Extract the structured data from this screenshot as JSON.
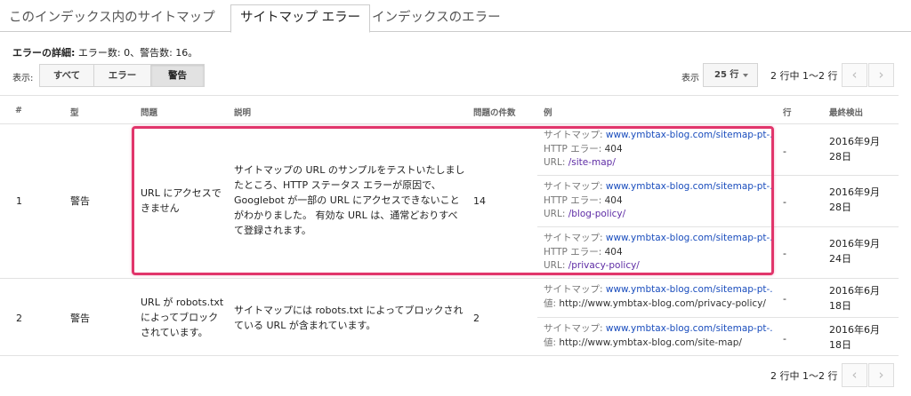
{
  "tabs": [
    {
      "label": "このインデックス内のサイトマップ"
    },
    {
      "label": "サイトマップ エラー"
    },
    {
      "label": "インデックスのエラー"
    }
  ],
  "details": {
    "title": "エラーの詳細:",
    "summary": " エラー数: 0、警告数: 16。"
  },
  "filter": {
    "label": "表示:",
    "options": [
      "すべて",
      "エラー",
      "警告"
    ],
    "selected": "警告"
  },
  "rows_per_page": {
    "label": "表示",
    "value": "25 行"
  },
  "pagination": {
    "text": "2 行中 1〜2 行",
    "prev": "‹",
    "next": "›"
  },
  "table": {
    "headers": {
      "num": "#",
      "type": "型",
      "issue": "問題",
      "description": "説明",
      "count": "問題の件数",
      "example": "例",
      "line": "行",
      "last_detected": "最終検出"
    },
    "rows": [
      {
        "num": "1",
        "type": "警告",
        "issue": "URL にアクセスできません",
        "description": "サイトマップの URL のサンプルをテストいたしましたところ、HTTP ステータス エラーが原因で、Googlebot が一部の URL にアクセスできないことがわかりました。 有効な URL は、通常どおりすべて登録されます。",
        "count": "14",
        "examples": [
          {
            "sitemap_label": "サイトマップ: ",
            "sitemap_url": "www.ymbtax-blog.com/sitemap-pt-...",
            "http_label": "HTTP エラー: ",
            "http_value": "404",
            "url_label": "URL: ",
            "url_value": "/site-map/",
            "line": "-",
            "date": "2016年9月28日"
          },
          {
            "sitemap_label": "サイトマップ: ",
            "sitemap_url": "www.ymbtax-blog.com/sitemap-pt-...",
            "http_label": "HTTP エラー: ",
            "http_value": "404",
            "url_label": "URL: ",
            "url_value": "/blog-policy/",
            "line": "-",
            "date": "2016年9月28日"
          },
          {
            "sitemap_label": "サイトマップ: ",
            "sitemap_url": "www.ymbtax-blog.com/sitemap-pt-...",
            "http_label": "HTTP エラー: ",
            "http_value": "404",
            "url_label": "URL: ",
            "url_value": "/privacy-policy/",
            "line": "-",
            "date": "2016年9月24日"
          }
        ]
      },
      {
        "num": "2",
        "type": "警告",
        "issue": "URL が robots.txt によってブロックされています。",
        "description": "サイトマップには robots.txt によってブロックされている URL が含まれています。",
        "count": "2",
        "examples": [
          {
            "sitemap_label": "サイトマップ: ",
            "sitemap_url": "www.ymbtax-blog.com/sitemap-pt-...",
            "value_label": "値: ",
            "value": "http://www.ymbtax-blog.com/privacy-policy/",
            "line": "-",
            "date": "2016年6月18日"
          },
          {
            "sitemap_label": "サイトマップ: ",
            "sitemap_url": "www.ymbtax-blog.com/sitemap-pt-...",
            "value_label": "値: ",
            "value": "http://www.ymbtax-blog.com/site-map/",
            "line": "-",
            "date": "2016年6月18日"
          }
        ]
      }
    ]
  },
  "colors": {
    "highlight": "#e1356b",
    "link": "#1a4dbd",
    "visited": "#5e2ca5"
  }
}
